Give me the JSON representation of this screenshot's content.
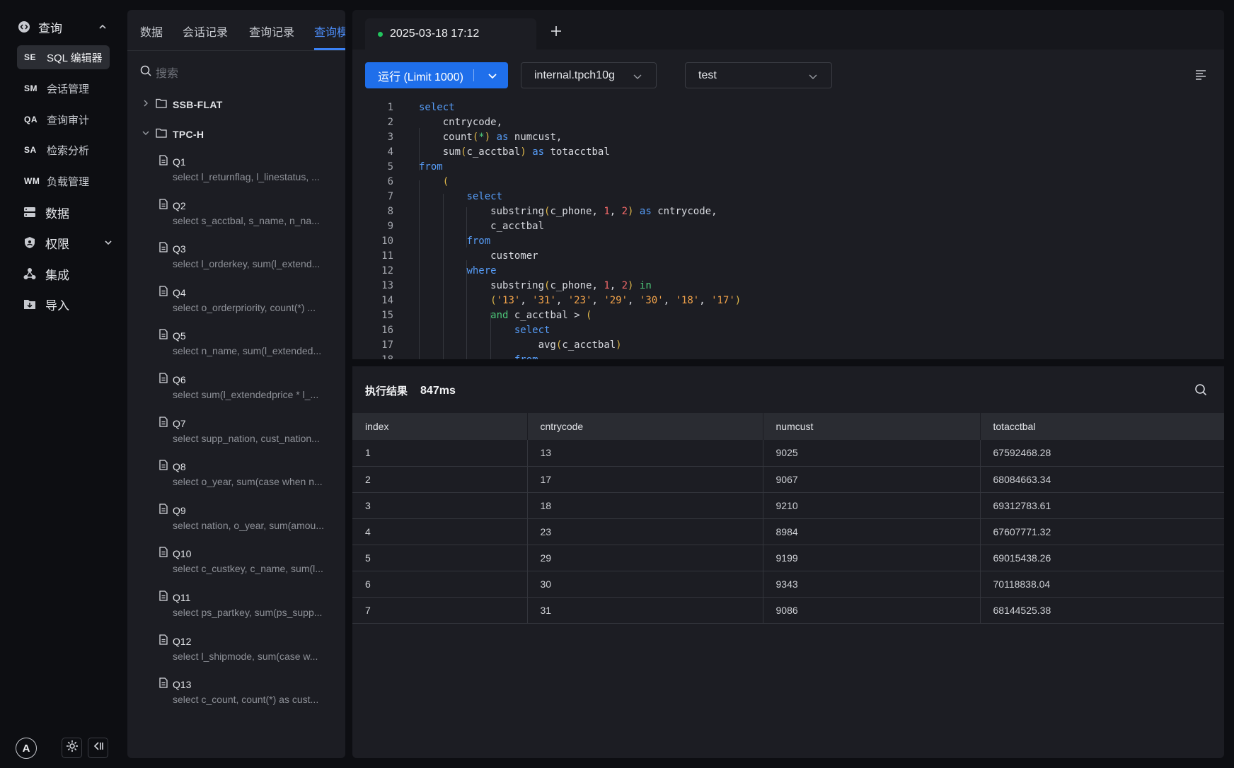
{
  "nav": {
    "section": "查询",
    "sub_items": [
      {
        "abbr": "SE",
        "label": "SQL 编辑器",
        "active": true
      },
      {
        "abbr": "SM",
        "label": "会话管理"
      },
      {
        "abbr": "QA",
        "label": "查询审计"
      },
      {
        "abbr": "SA",
        "label": "检索分析"
      },
      {
        "abbr": "WM",
        "label": "负载管理"
      }
    ],
    "main_items": [
      {
        "label": "数据",
        "icon": "database-icon"
      },
      {
        "label": "权限",
        "icon": "shield-icon"
      },
      {
        "label": "集成",
        "icon": "integration-icon"
      },
      {
        "label": "导入",
        "icon": "import-icon"
      }
    ],
    "avatar": "A"
  },
  "tree": {
    "tabs": [
      "数据",
      "会话记录",
      "查询记录",
      "查询模板"
    ],
    "search_placeholder": "搜索",
    "folders": [
      "SSB-FLAT",
      "TPC-H"
    ],
    "queries": [
      {
        "name": "Q1",
        "sql": "select l_returnflag, l_linestatus, ..."
      },
      {
        "name": "Q2",
        "sql": "select s_acctbal, s_name, n_na..."
      },
      {
        "name": "Q3",
        "sql": "select l_orderkey, sum(l_extend..."
      },
      {
        "name": "Q4",
        "sql": "select o_orderpriority, count(*) ..."
      },
      {
        "name": "Q5",
        "sql": "select n_name, sum(l_extended..."
      },
      {
        "name": "Q6",
        "sql": "select sum(l_extendedprice * l_..."
      },
      {
        "name": "Q7",
        "sql": "select supp_nation, cust_nation..."
      },
      {
        "name": "Q8",
        "sql": "select o_year, sum(case when n..."
      },
      {
        "name": "Q9",
        "sql": "select nation, o_year, sum(amou..."
      },
      {
        "name": "Q10",
        "sql": "select c_custkey, c_name, sum(l..."
      },
      {
        "name": "Q11",
        "sql": "select ps_partkey, sum(ps_supp..."
      },
      {
        "name": "Q12",
        "sql": "select l_shipmode, sum(case w..."
      },
      {
        "name": "Q13",
        "sql": "select c_count, count(*) as cust..."
      }
    ]
  },
  "editor": {
    "tab_title": "2025-03-18 17:12",
    "run_label": "运行 (Limit 1000)",
    "catalog": "internal.tpch10g",
    "database": "test"
  },
  "results": {
    "title": "执行结果",
    "duration": "847ms",
    "columns": [
      "index",
      "cntrycode",
      "numcust",
      "totacctbal"
    ],
    "rows": [
      [
        "1",
        "13",
        "9025",
        "67592468.28"
      ],
      [
        "2",
        "17",
        "9067",
        "68084663.34"
      ],
      [
        "3",
        "18",
        "9210",
        "69312783.61"
      ],
      [
        "4",
        "23",
        "8984",
        "67607771.32"
      ],
      [
        "5",
        "29",
        "9199",
        "69015438.26"
      ],
      [
        "6",
        "30",
        "9343",
        "70118838.04"
      ],
      [
        "7",
        "31",
        "9086",
        "68144525.38"
      ]
    ]
  }
}
